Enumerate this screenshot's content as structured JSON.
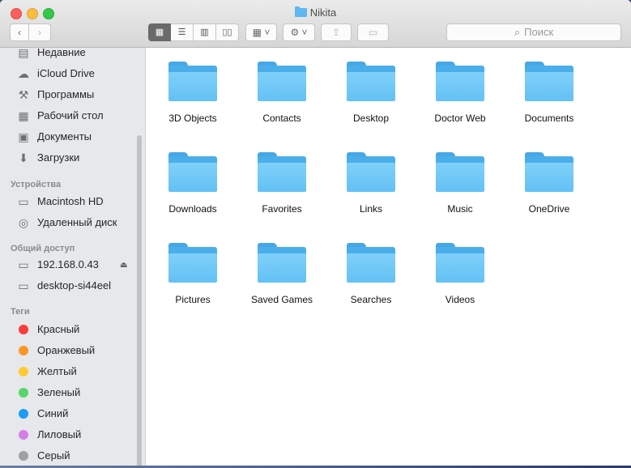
{
  "window": {
    "title": "Nikita"
  },
  "toolbar": {
    "back_label": "‹",
    "forward_label": "›",
    "search_placeholder": "Поиск"
  },
  "sidebar": {
    "favorites": [
      {
        "label": "Недавние",
        "icon": "recents-icon",
        "glyph": "▤"
      },
      {
        "label": "iCloud Drive",
        "icon": "cloud-icon",
        "glyph": "☁"
      },
      {
        "label": "Программы",
        "icon": "applications-icon",
        "glyph": "⚒"
      },
      {
        "label": "Рабочий стол",
        "icon": "desktop-icon",
        "glyph": "▦"
      },
      {
        "label": "Документы",
        "icon": "documents-icon",
        "glyph": "▣"
      },
      {
        "label": "Загрузки",
        "icon": "downloads-icon",
        "glyph": "⬇"
      }
    ],
    "devices_header": "Устройства",
    "devices": [
      {
        "label": "Macintosh HD",
        "icon": "hard-drive-icon",
        "glyph": "▭"
      },
      {
        "label": "Удаленный диск",
        "icon": "remote-disc-icon",
        "glyph": "◎"
      }
    ],
    "shared_header": "Общий доступ",
    "shared": [
      {
        "label": "192.168.0.43",
        "icon": "network-computer-icon",
        "glyph": "▭"
      },
      {
        "label": "desktop-si44eel",
        "icon": "network-computer-icon",
        "glyph": "▭"
      }
    ],
    "tags_header": "Теги",
    "tags": [
      {
        "label": "Красный",
        "color": "#fc3d39"
      },
      {
        "label": "Оранжевый",
        "color": "#fd9426"
      },
      {
        "label": "Желтый",
        "color": "#fecb2e"
      },
      {
        "label": "Зеленый",
        "color": "#53d769"
      },
      {
        "label": "Синий",
        "color": "#1d9bf6"
      },
      {
        "label": "Лиловый",
        "color": "#d57ee9"
      },
      {
        "label": "Серый",
        "color": "#a0a0a0"
      }
    ]
  },
  "folders": [
    "3D Objects",
    "Contacts",
    "Desktop",
    "Doctor Web",
    "Documents",
    "Downloads",
    "Favorites",
    "Links",
    "Music",
    "OneDrive",
    "Pictures",
    "Saved Games",
    "Searches",
    "Videos"
  ]
}
